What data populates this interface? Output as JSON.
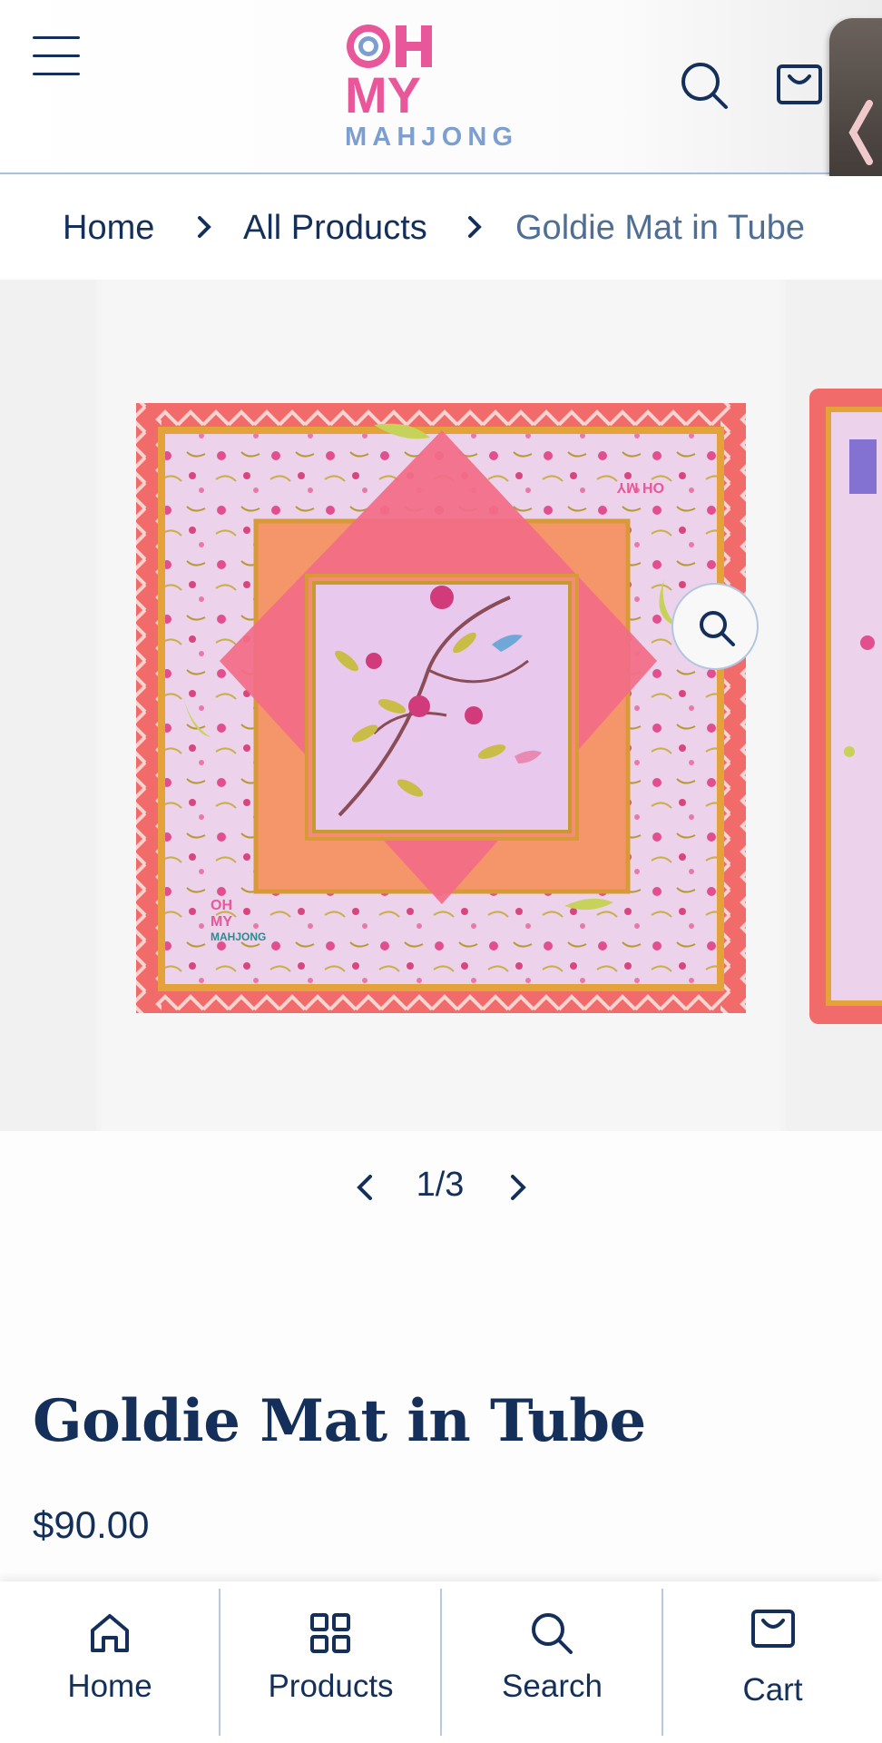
{
  "brand": {
    "logo_line1": "OH",
    "logo_line2": "MY",
    "logo_line3": "MAHJONG",
    "pink": "#e8579a",
    "blue": "#7d9fd0",
    "navy": "#14305a"
  },
  "header": {
    "menu_icon": "hamburger-menu-icon",
    "search_icon": "search-icon",
    "cart_icon": "shopping-bag-icon"
  },
  "breadcrumb": {
    "home": "Home",
    "all_products": "All Products",
    "current": "Goldie Mat in Tube"
  },
  "gallery": {
    "counter": "1/3",
    "zoom_icon": "magnifier-icon"
  },
  "product": {
    "title": "Goldie Mat in Tube",
    "price": "$90.00"
  },
  "bottom_nav": [
    {
      "label": "Home",
      "icon": "home-icon"
    },
    {
      "label": "Products",
      "icon": "grid-icon"
    },
    {
      "label": "Search",
      "icon": "search-icon"
    },
    {
      "label": "Cart",
      "icon": "shopping-bag-icon"
    }
  ]
}
